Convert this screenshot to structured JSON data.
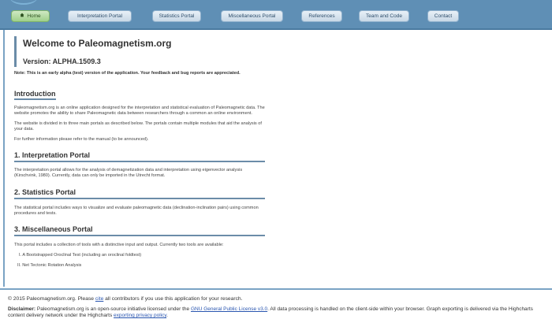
{
  "nav": {
    "home": "Home",
    "interpretation": "Interpretation Portal",
    "statistics": "Statistics Portal",
    "miscellaneous": "Miscellaneous Portal",
    "references": "References",
    "team": "Team and Code",
    "contact": "Contact"
  },
  "welcome": {
    "title": "Welcome to Paleomagnetism.org",
    "version": "Version: ALPHA.1509.3",
    "note": "Note: This is an early alpha (test) version of the application. Your feedback and bug reports are appreciated."
  },
  "intro": {
    "title": "Introduction",
    "p1": "Paleomagnetism.org is an online application designed for the interpretation and statistical evaluation of Paleomagnetic data. The website promotes the ability to share Paleomagnetic data between researchers through a common an online environment.",
    "p2": "The website is divided in to three main portals as described below. The portals contain multiple modules that aid the analysis of your data.",
    "p3": "For further information please refer to the manual (to be announced)."
  },
  "sec1": {
    "title": "1. Interpretation Portal",
    "p": "The interpretation portal allows for the analysis of demagnetization data and interpretation using eigenvector analysis (Kirschvink, 1980). Currently, data can only be imported in the Utrecht format."
  },
  "sec2": {
    "title": "2. Statistics Portal",
    "p": "The statistical portal includes ways to visualize and evaluate paleomagnetic data (declination-inclination pairs) using common procedures and tests."
  },
  "sec3": {
    "title": "3. Miscellaneous Portal",
    "p": "This portal includes a collection of tools with a distinctive input and output. Currently two tools are available:",
    "items": [
      "I.  A Bootstrapped Oroclinal Test (including an oroclinal foldtest)",
      "II.  Net Tectonic Rotation Analysis"
    ]
  },
  "footer": {
    "copy_pre": "© 2015 Paleomagnetism.org. Please ",
    "cite": "cite",
    "copy_post": " all contributors if you use this application for your research.",
    "disc_label": "Disclaimer:",
    "disc_pre": " Paleomagnetism.org is an open-source initiative licensed under the ",
    "license": "GNU General Public License v3.0",
    "disc_mid": ". All data processing is handled on the client-side within your browser. Graph exporting is delivered via the Highcharts content delivery network under the Highcharts ",
    "privacy": "exporting privacy policy",
    "disc_end": "."
  }
}
